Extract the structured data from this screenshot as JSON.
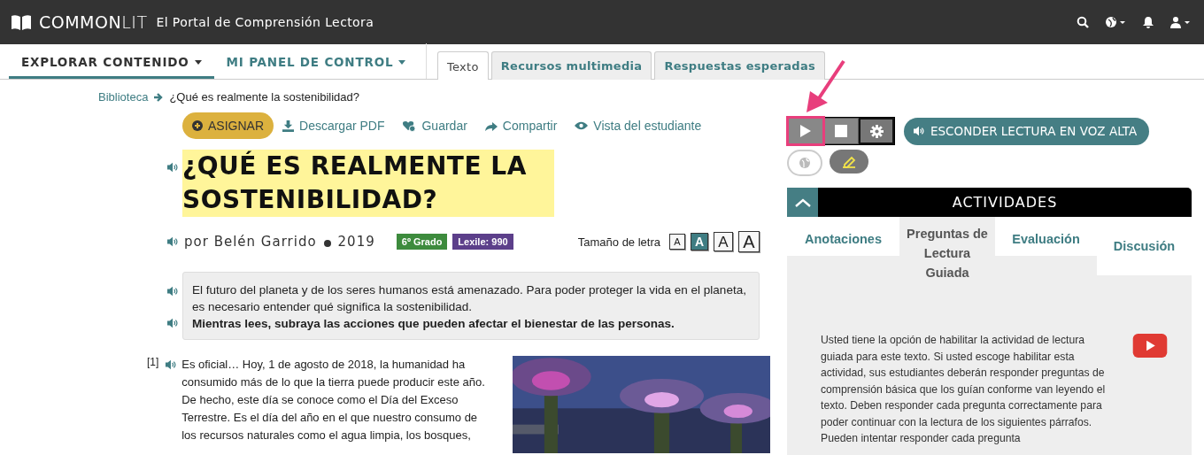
{
  "header": {
    "logo": "**COMMON**LIT",
    "tagline": "El Portal de Comprensión Lectora"
  },
  "nav": [
    {
      "label": "EXPLORAR CONTENIDO",
      "selected": true
    },
    {
      "label": "MI PANEL DE CONTROL",
      "selected": false
    }
  ],
  "content_tabs": [
    {
      "label": "Texto",
      "selected": true
    },
    {
      "label": "Recursos multimedia",
      "selected": false
    },
    {
      "label": "Respuestas esperadas",
      "selected": false
    }
  ],
  "breadcrumb": {
    "parent": "Biblioteca",
    "current": "¿Qué es realmente la sostenibilidad?"
  },
  "actions": [
    {
      "kind": "primary",
      "label": "ASIGNAR"
    },
    {
      "kind": "download",
      "label": "Descargar PDF"
    },
    {
      "kind": "save",
      "label": "Guardar"
    },
    {
      "kind": "share",
      "label": "Compartir"
    },
    {
      "kind": "view",
      "label": "Vista del estudiante"
    }
  ],
  "title": "¿QUÉ ES REALMENTE LA SOSTENIBILIDAD?",
  "byline": {
    "author": "por Belén Garrido",
    "year": "2019",
    "grade": "6º Grado",
    "lexile": "Lexile: 990"
  },
  "font_size": {
    "label": "Tamaño de letra",
    "options": [
      {
        "label": "A",
        "selected": false
      },
      {
        "label": "A",
        "selected": true
      },
      {
        "label": "A",
        "selected": false
      },
      {
        "label": "A",
        "selected": false
      }
    ]
  },
  "intro": [
    {
      "text": "El futuro del planeta y de los seres humanos está amenazado. Para poder proteger la vida en el planeta, es necesario entender qué significa la sostenibilidad.",
      "bold": false
    },
    {
      "text": "Mientras lees, subraya las acciones que pueden afectar el bienestar de las personas.",
      "bold": true
    }
  ],
  "paragraph": {
    "number": "[1]",
    "text": "Es oficial… Hoy, 1 de agosto de 2018, la humanidad ha consumido más de lo que la tierra puede producir este año. De hecho, este día se conoce como el Día del Exceso Terrestre. Es el día del año en el que nuestro consumo de los recursos naturales como el agua limpia, los bosques,"
  },
  "audio": {
    "playing_highlighted": true,
    "toggle_label": "ESCONDER LECTURA EN VOZ ALTA"
  },
  "activities": {
    "title": "ACTIVIDADES",
    "tabs": [
      {
        "label": "Anotaciones",
        "selected": false
      },
      {
        "label": "Preguntas de Lectura Guiada",
        "selected": true
      },
      {
        "label": "Evaluación",
        "selected": false
      },
      {
        "label": "Discusión",
        "selected": false
      }
    ],
    "description": "Usted tiene la opción de habilitar la actividad de lectura guiada para este texto. Si usted escoge habilitar esta actividad, sus estudiantes deberán responder preguntas de comprensión básica que los guían conforme van leyendo el texto. Deben responder cada pregunta correctamente para poder continuar con la lectura de los siguientes párrafos. Pueden intentar responder cada pregunta"
  }
}
